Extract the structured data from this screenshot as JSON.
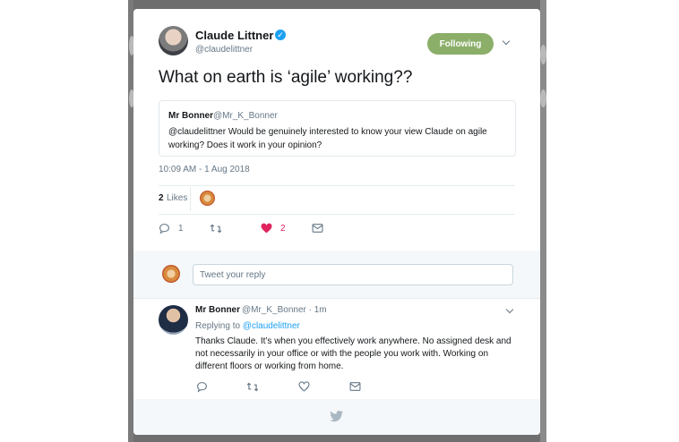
{
  "tweet": {
    "author_name": "Claude Littner",
    "author_handle": "@claudelittner",
    "follow_label": "Following",
    "text": "What on earth is ‘agile’ working??",
    "quote": {
      "name": "Mr Bonner",
      "handle": "@Mr_K_Bonner",
      "text": "@claudelittner Would be genuinely interested to know your view Claude on agile working?  Does it work in your opinion?"
    },
    "timestamp": "10:09 AM - 1 Aug 2018",
    "likes_count": "2",
    "likes_label": "Likes",
    "actions": {
      "replies": "1",
      "likes": "2"
    }
  },
  "reply_box": {
    "placeholder": "Tweet your reply"
  },
  "reply": {
    "name": "Mr Bonner",
    "handle_time": "@Mr_K_Bonner · 1m",
    "replying_prefix": "Replying to ",
    "replying_to": "@claudelittner",
    "text": "Thanks Claude. It’s when you effectively work anywhere.  No assigned desk and not necessarily in your office or with the people you work with.  Working on different floors or working from home."
  },
  "colors": {
    "accent": "#1da1f2",
    "follow_bg": "#8bae69",
    "like": "#e0245e",
    "muted": "#657786"
  },
  "icons": [
    "verified-icon",
    "chevron-down-icon",
    "reply-icon",
    "retweet-icon",
    "heart-icon",
    "message-icon",
    "twitter-bird-icon"
  ]
}
